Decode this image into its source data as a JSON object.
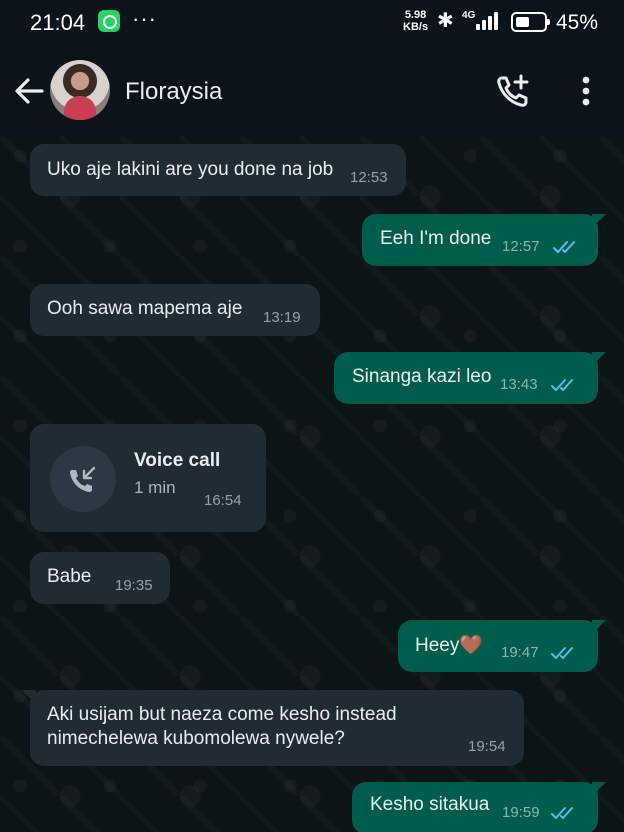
{
  "status_bar": {
    "time": "21:04",
    "app_icon": "whatsapp-business-icon",
    "overflow": "···",
    "speed_value": "5.98",
    "speed_unit": "KB/s",
    "network": "4G",
    "battery": "45%"
  },
  "header": {
    "back_icon": "arrow-left-icon",
    "contact_name": "Floraysia",
    "call_icon": "add-call-icon",
    "menu_icon": "more-vertical-icon"
  },
  "messages": [
    {
      "dir": "in",
      "text": "Uko aje lakini are you done na job",
      "time": "12:53"
    },
    {
      "dir": "out",
      "text": "Eeh I'm done",
      "time": "12:57",
      "status": "read"
    },
    {
      "dir": "in",
      "text": "Ooh sawa mapema aje",
      "time": "13:19"
    },
    {
      "dir": "out",
      "text": "Sinanga kazi leo",
      "time": "13:43",
      "status": "read"
    },
    {
      "dir": "in",
      "type": "call",
      "title": "Voice call",
      "duration": "1 min",
      "time": "16:54"
    },
    {
      "dir": "in",
      "text": "Babe",
      "time": "19:35"
    },
    {
      "dir": "out",
      "text": "Heey🤎",
      "time": "19:47",
      "status": "read"
    },
    {
      "dir": "in",
      "text_line1": "Aki usijam but naeza come kesho instead",
      "text_line2": "nimechelewa kubomolewa nywele?",
      "time": "19:54"
    },
    {
      "dir": "out",
      "text": "Kesho sitakua",
      "time": "19:59",
      "status": "read"
    }
  ],
  "colors": {
    "incoming_bubble": "#202c33",
    "outgoing_bubble": "#005c4b",
    "read_ticks": "#53bdeb",
    "background": "#0b141a"
  }
}
